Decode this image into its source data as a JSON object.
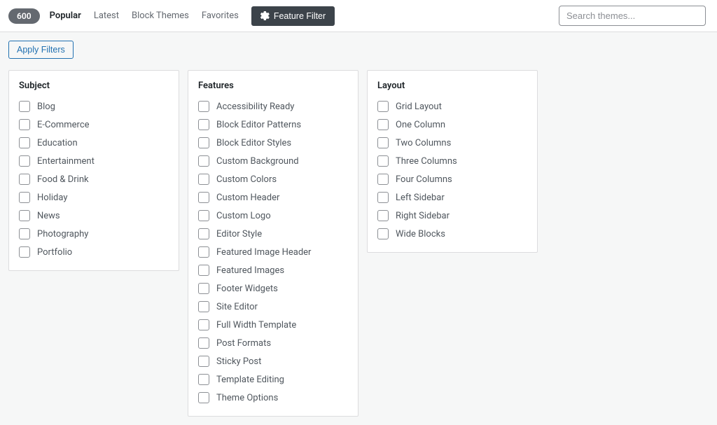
{
  "toolbar": {
    "count": "600",
    "tabs": {
      "popular": "Popular",
      "latest": "Latest",
      "block_themes": "Block Themes",
      "favorites": "Favorites"
    },
    "feature_filter_label": "Feature Filter",
    "search_placeholder": "Search themes..."
  },
  "apply_filters_label": "Apply Filters",
  "filters": {
    "subject": {
      "title": "Subject",
      "items": [
        "Blog",
        "E-Commerce",
        "Education",
        "Entertainment",
        "Food & Drink",
        "Holiday",
        "News",
        "Photography",
        "Portfolio"
      ]
    },
    "features": {
      "title": "Features",
      "items": [
        "Accessibility Ready",
        "Block Editor Patterns",
        "Block Editor Styles",
        "Custom Background",
        "Custom Colors",
        "Custom Header",
        "Custom Logo",
        "Editor Style",
        "Featured Image Header",
        "Featured Images",
        "Footer Widgets",
        "Site Editor",
        "Full Width Template",
        "Post Formats",
        "Sticky Post",
        "Template Editing",
        "Theme Options"
      ]
    },
    "layout": {
      "title": "Layout",
      "items": [
        "Grid Layout",
        "One Column",
        "Two Columns",
        "Three Columns",
        "Four Columns",
        "Left Sidebar",
        "Right Sidebar",
        "Wide Blocks"
      ]
    }
  }
}
